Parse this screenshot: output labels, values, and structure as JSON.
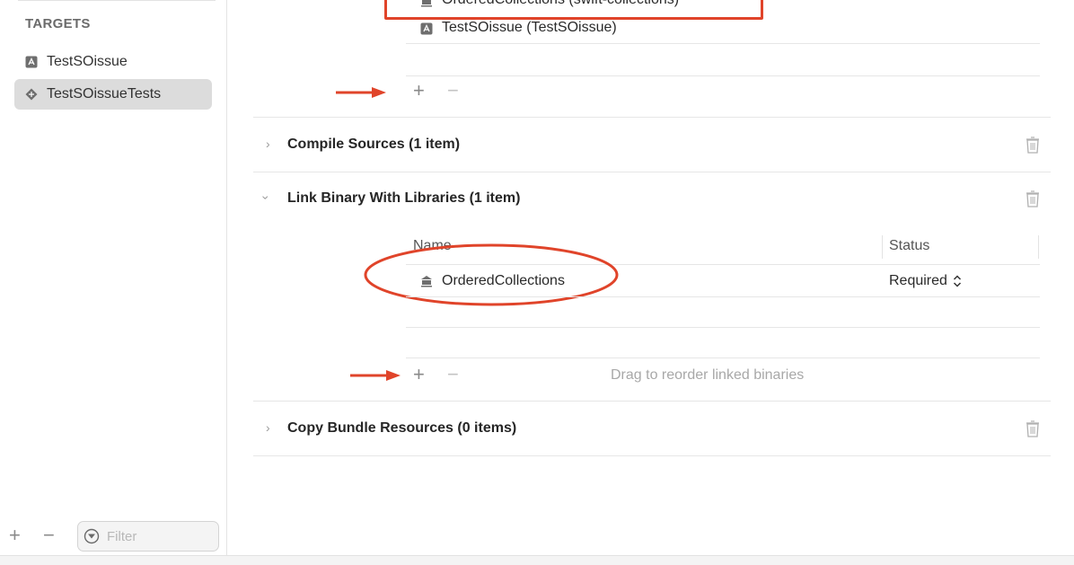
{
  "sidebar": {
    "heading": "TARGETS",
    "items": [
      {
        "label": "TestSOissue",
        "icon": "app-target-icon",
        "selected": false
      },
      {
        "label": "TestSOissueTests",
        "icon": "test-bundle-icon",
        "selected": true
      }
    ],
    "filter_placeholder": "Filter"
  },
  "dependencies": {
    "partial_item_label": "OrderedCollections (swift-collections)",
    "item_label": "TestSOissue (TestSOissue)"
  },
  "phases": [
    {
      "title": "Compile Sources (1 item)",
      "expanded": false
    },
    {
      "title": "Link Binary With Libraries (1 item)",
      "expanded": true
    },
    {
      "title": "Copy Bundle Resources (0 items)",
      "expanded": false
    }
  ],
  "link_table": {
    "columns": [
      "Name",
      "Status"
    ],
    "rows": [
      {
        "name": "OrderedCollections",
        "status": "Required"
      }
    ],
    "hint": "Drag to reorder linked binaries"
  },
  "colors": {
    "annotation": "#e0442a",
    "selected_row": "#dcdcdc"
  }
}
